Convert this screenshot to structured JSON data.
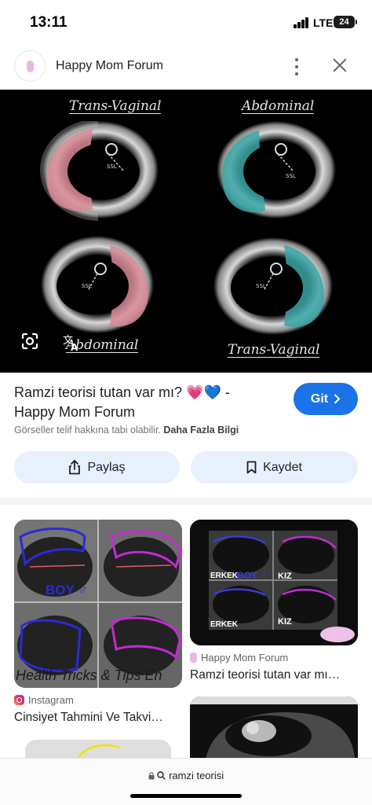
{
  "status_bar": {
    "time": "13:11",
    "network": "LTE",
    "battery": "24"
  },
  "header": {
    "site_name": "Happy Mom Forum"
  },
  "main_image": {
    "labels": {
      "top_left": "Trans-Vaginal",
      "top_right": "Abdominal",
      "bottom_left": "Abdominal",
      "bottom_right": "Trans-Vaginal"
    },
    "colors": {
      "pink_overlay": "#d98a95",
      "teal_overlay": "#3aa6a6"
    }
  },
  "info": {
    "title": "Ramzi teorisi tutan var mı? 💗💙 - Happy Mom Forum",
    "go_button": "Git",
    "copyright_text": "Görseller telif hakkına tabi olabilir.",
    "more_info_link": "Daha Fazla Bilgi"
  },
  "actions": {
    "share": "Paylaş",
    "save": "Kaydet"
  },
  "related": [
    {
      "source": "Instagram",
      "title": "Cinsiyet Tahmini Ve Takvi…",
      "image_text": {
        "boy": "BOY ♂",
        "watermark": "Health Tricks & Tips En"
      }
    },
    {
      "source": "Happy Mom Forum",
      "title": "Ramzi teorisi tutan var mı…",
      "image_text": {
        "label_a": "ERKEK",
        "label_b": "BOY ♂",
        "label_c": "KIZ",
        "label_d": "ERKEK",
        "label_e": "KIZ"
      }
    }
  ],
  "bottom_bar": {
    "url_text": "ramzi teorisi"
  },
  "colors": {
    "accent": "#1a73e8",
    "chip_bg": "#e8f0fe"
  }
}
